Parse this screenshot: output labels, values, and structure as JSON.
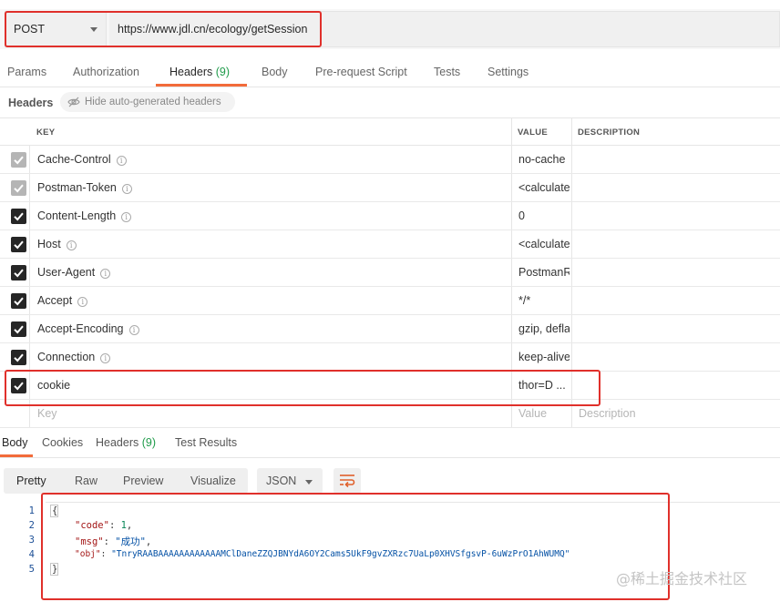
{
  "request": {
    "method": "POST",
    "url": "https://www.jdl.cn/ecology/getSession"
  },
  "tabs": [
    {
      "label": "Params"
    },
    {
      "label": "Authorization"
    },
    {
      "label": "Headers",
      "count": "(9)"
    },
    {
      "label": "Body"
    },
    {
      "label": "Pre-request Script"
    },
    {
      "label": "Tests"
    },
    {
      "label": "Settings"
    }
  ],
  "headers_bar": {
    "title": "Headers",
    "hide_label": "Hide auto-generated headers"
  },
  "table": {
    "col_key": "KEY",
    "col_value": "VALUE",
    "col_description": "DESCRIPTION",
    "rows": [
      {
        "key": "Cache-Control",
        "value": "no-cache"
      },
      {
        "key": "Postman-Token",
        "value": "<calculated when request is sent>"
      },
      {
        "key": "Content-Length",
        "value": "0"
      },
      {
        "key": "Host",
        "value": "<calculated when request is sent>"
      },
      {
        "key": "User-Agent",
        "value": "PostmanRuntime"
      },
      {
        "key": "Accept",
        "value": "*/*"
      },
      {
        "key": "Accept-Encoding",
        "value": "gzip, deflate, br"
      },
      {
        "key": "Connection",
        "value": "keep-alive"
      },
      {
        "key": "cookie",
        "value": "thor=D ..."
      }
    ],
    "placeholder": {
      "key": "Key",
      "value": "Value",
      "description": "Description"
    }
  },
  "response_tabs": [
    {
      "label": "Body"
    },
    {
      "label": "Cookies"
    },
    {
      "label": "Headers",
      "count": "(9)"
    },
    {
      "label": "Test Results"
    }
  ],
  "format": {
    "modes": [
      "Pretty",
      "Raw",
      "Preview",
      "Visualize"
    ],
    "language": "JSON"
  },
  "code": {
    "line_numbers": [
      "1",
      "2",
      "3",
      "4",
      "5"
    ],
    "open_brace": "{",
    "close_brace": "}",
    "entries": [
      {
        "key": "\"code\"",
        "sep": ": ",
        "value": "1",
        "tail": ","
      },
      {
        "key": "\"msg\"",
        "sep": ": ",
        "value": "\"成功\"",
        "tail": ","
      },
      {
        "key": "\"obj\"",
        "sep": ": ",
        "value": "\"TnryRAABAAAAAAAAAAAAMClDaneZZQJBNYdA6OY2Cams5UkF9gvZXRzc7UaLp0XHVSfgsvP-6uWzPrO1AhWUMQ\"",
        "tail": ""
      }
    ]
  },
  "watermark": "@稀土掘金技术社区",
  "colors": {
    "highlight": "#e0302b",
    "accent": "#f26b3a",
    "count_green": "#1f9b4a"
  }
}
